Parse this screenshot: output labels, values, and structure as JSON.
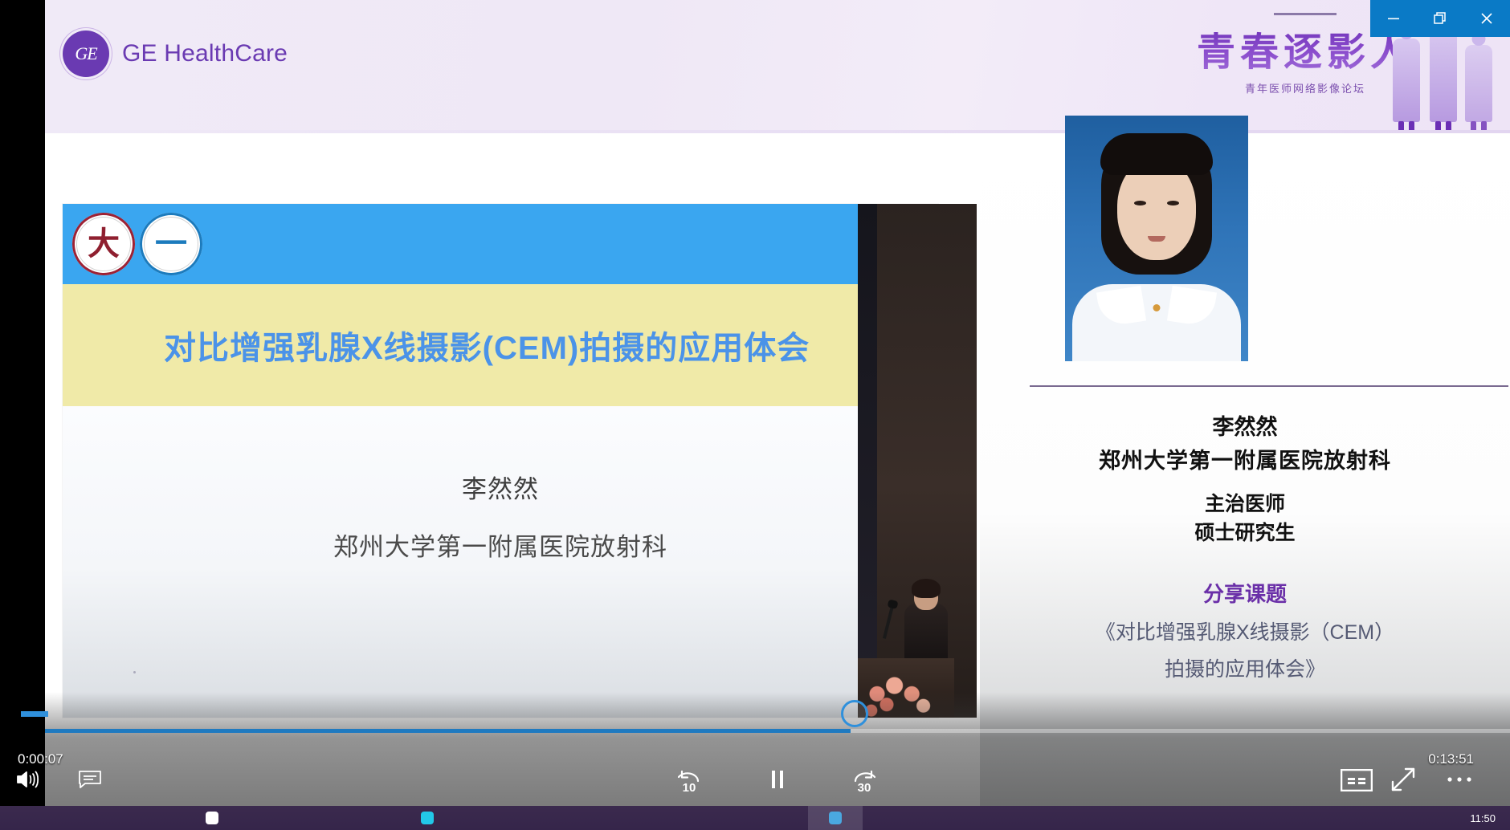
{
  "window": {
    "minimize_label": "—",
    "restore_label": "❐",
    "close_label": "✕"
  },
  "header": {
    "brand": "GE HealthCare",
    "brand_mark": "GE",
    "banner_title": "青春逐影人",
    "banner_subtitle": "青年医师网络影像论坛"
  },
  "slide": {
    "title": "对比增强乳腺X线摄影(CEM)拍摄的应用体会",
    "presenter": "李然然",
    "affiliation": "郑州大学第一附属医院放射科",
    "logo_left_mark": "大",
    "logo_right_mark": "一"
  },
  "info_panel": {
    "name": "李然然",
    "affiliation": "郑州大学第一附属医院放射科",
    "role_title": "主治医师",
    "role_degree": "硕士研究生",
    "topic_label": "分享课题",
    "topic_line1": "《对比增强乳腺X线摄影（CEM）",
    "topic_line2": "拍摄的应用体会》"
  },
  "player": {
    "current_time": "0:00:07",
    "total_time": "0:13:51",
    "progress_percent": 55,
    "volume_icon": "volume-icon",
    "caption_bubble_icon": "comment-icon",
    "rewind_label": "10",
    "forward_label": "30",
    "play_state": "paused",
    "cc_label": "CC",
    "fullscreen_icon": "expand-icon",
    "more_icon": "more-options-icon"
  },
  "taskbar": {
    "clock": "11:50",
    "items": [
      {
        "name": "app-1",
        "color": "#ffffff"
      },
      {
        "name": "app-2",
        "color": "#e8e8e8"
      },
      {
        "name": "app-3",
        "color": "#22c8e8"
      },
      {
        "name": "app-4",
        "color": "#f0f0f0"
      },
      {
        "name": "app-5",
        "color": "#4aa8e0"
      }
    ]
  }
}
